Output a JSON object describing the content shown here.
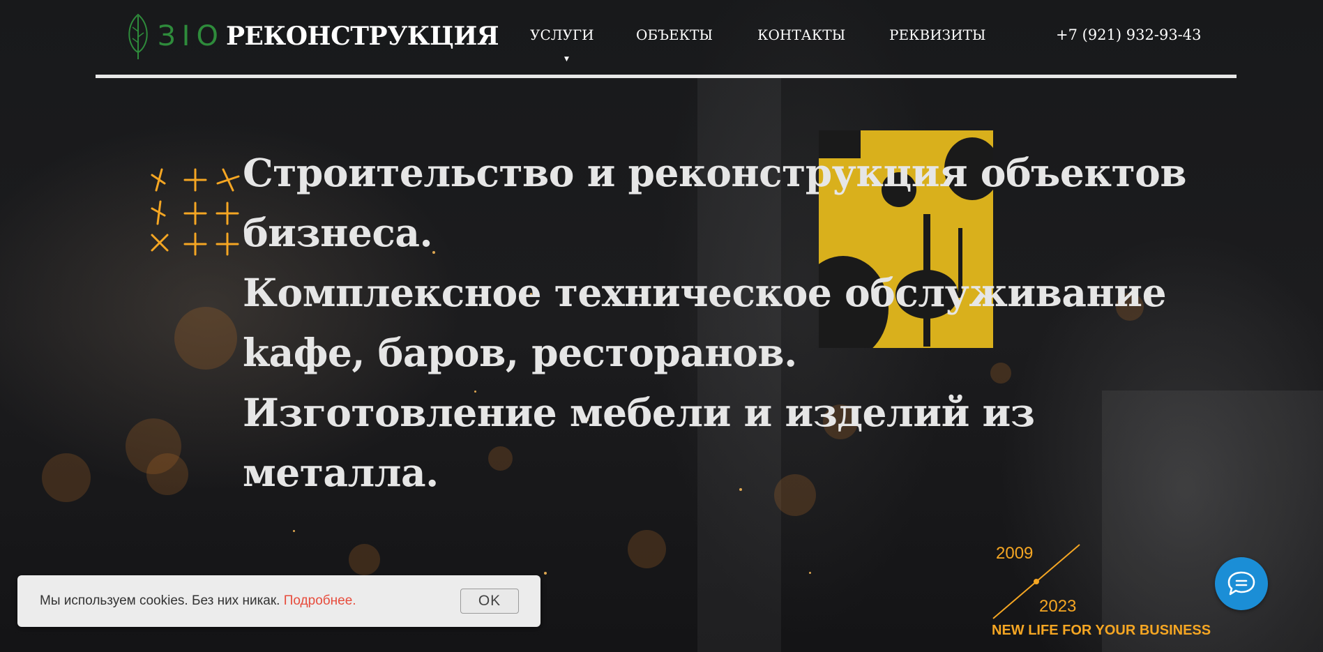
{
  "header": {
    "logo_bio": "ЗIО",
    "logo_main": "РЕКОНСТРУКЦИЯ",
    "nav": [
      {
        "label": "УСЛУГИ",
        "has_dropdown": true
      },
      {
        "label": "ОБЪЕКТЫ"
      },
      {
        "label": "КОНТАКТЫ"
      },
      {
        "label": "РЕКВИЗИТЫ"
      }
    ],
    "phone": "+7 (921) 932-93-43"
  },
  "hero": {
    "lines": [
      "Строительство и реконструкция объектов",
      "бизнеса.",
      "Комплексное техническое обслуживание",
      "kафе, баров, ресторанов.",
      "Изготовление мебели и изделий из",
      "металла."
    ]
  },
  "timeline": {
    "year_start": "2009",
    "year_end": "2023",
    "slogan": "NEW LIFE FOR YOUR BUSINESS"
  },
  "cookie": {
    "text": "Мы используем cookies. Без них никак.",
    "link": "Подробнее.",
    "ok": "OK"
  },
  "colors": {
    "accent": "#f5a623",
    "brand_green": "#2e8b3b",
    "chat": "#1b8ed6",
    "link": "#e74c3c"
  },
  "icons": {
    "logo": "leaf-icon",
    "chat": "chat-bubble-icon",
    "decor": "crosses-decoration-icon"
  }
}
